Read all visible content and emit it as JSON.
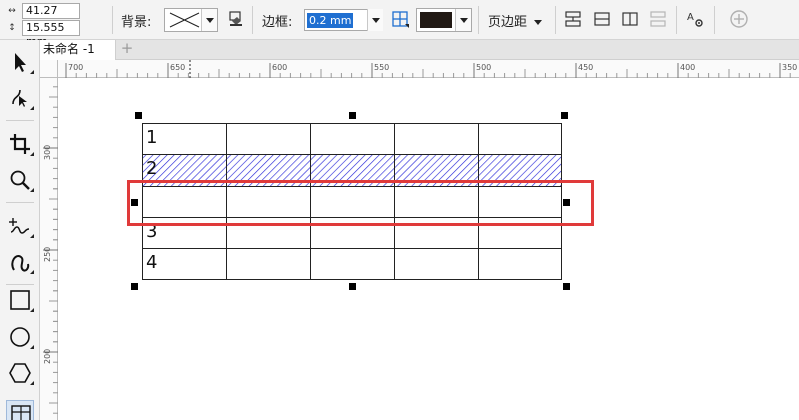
{
  "property_bar": {
    "width_value": "41.27 mm",
    "height_value": "15.555 mm",
    "background_label": "背景:",
    "border_label": "边框:",
    "border_width": "0.2 mm",
    "page_margin_label": "页边距",
    "border_color": "#221a15"
  },
  "document": {
    "tab_title": "未命名 -1"
  },
  "rulers": {
    "horizontal_ticks": [
      "700",
      "650",
      "600",
      "550",
      "500",
      "450",
      "400",
      "350"
    ],
    "vertical_ticks": [
      "300",
      "250",
      "200"
    ]
  },
  "table": {
    "rows": [
      "1",
      "2",
      "",
      "3",
      "4"
    ],
    "columns": 5,
    "hatched_row_index": 1,
    "hatch_color": "#2b2bd9",
    "highlight_color": "#e03a3a"
  }
}
